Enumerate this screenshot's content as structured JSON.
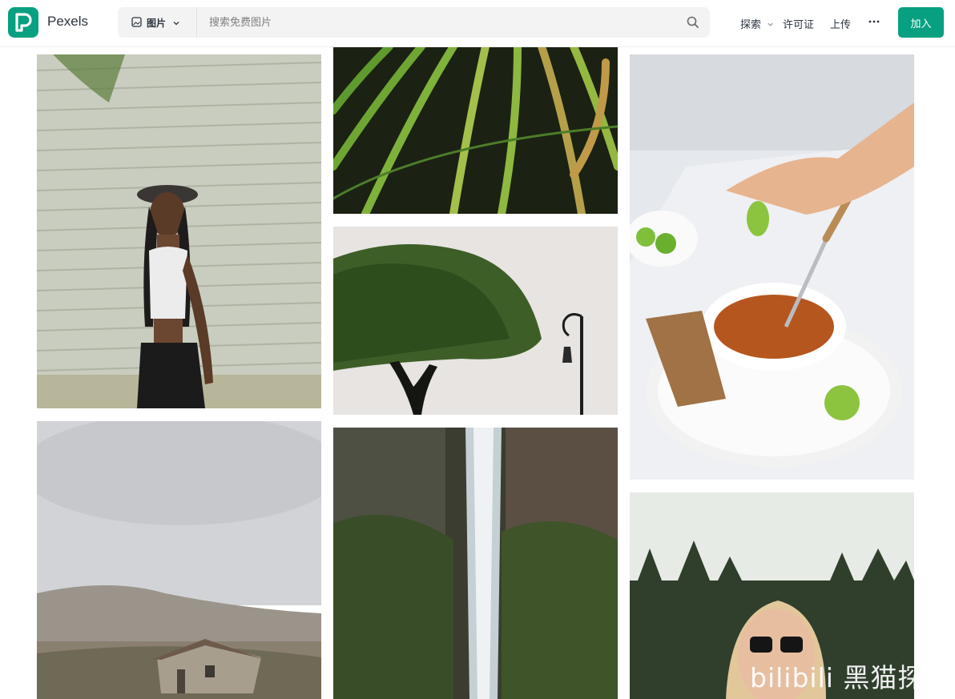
{
  "header": {
    "brand": "Pexels",
    "search": {
      "type_label": "图片",
      "placeholder": "搜索免费图片"
    },
    "nav": {
      "explore": "探索",
      "license": "许可证",
      "upload": "上传"
    },
    "join_label": "加入"
  },
  "watermark": {
    "text": "bilibili 黑猫探"
  },
  "colors": {
    "brand_green": "#07a081"
  }
}
